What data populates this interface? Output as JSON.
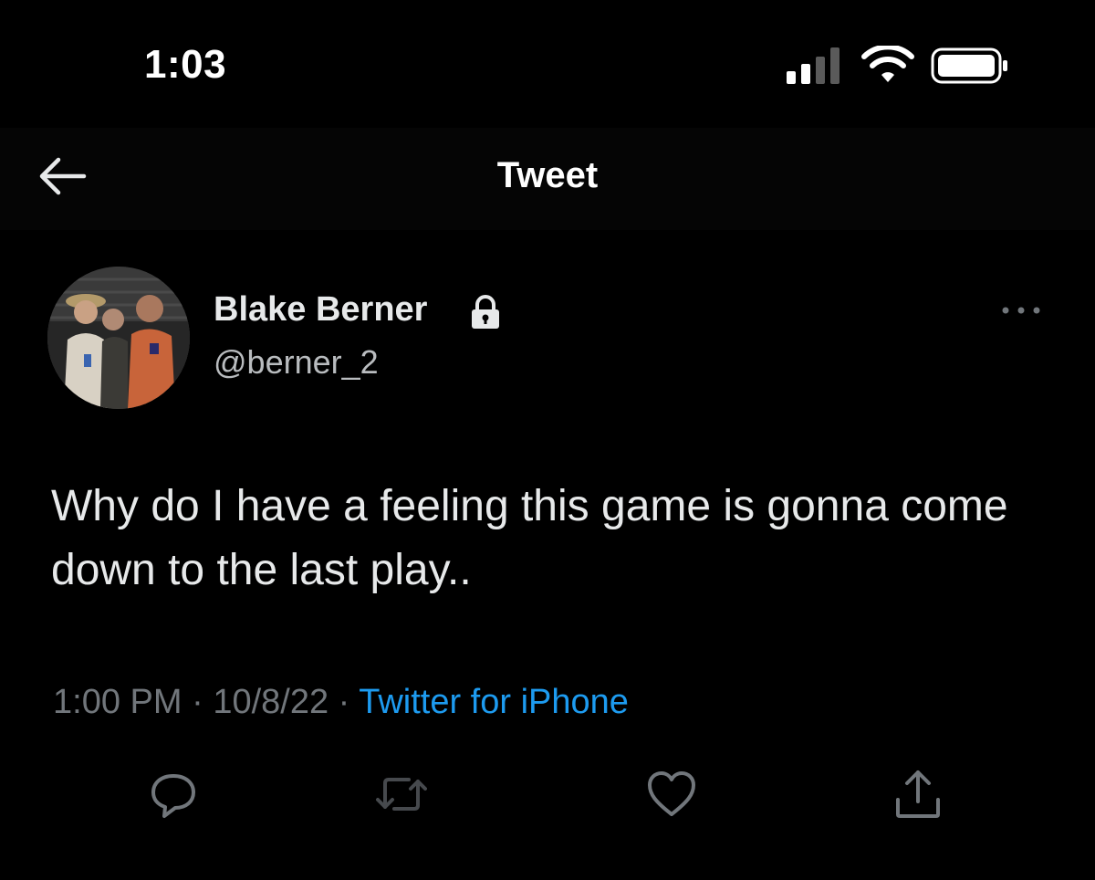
{
  "status_bar": {
    "time": "1:03",
    "signal_icon": "cellular-signal-icon",
    "wifi_icon": "wifi-icon",
    "battery_icon": "battery-icon"
  },
  "header": {
    "back_icon": "back-arrow-icon",
    "title": "Tweet"
  },
  "tweet": {
    "author": {
      "avatar": "avatar",
      "name": "Blake Berner",
      "protected_icon": "lock-icon",
      "handle": "@berner_2"
    },
    "more_icon": "more-options-icon",
    "text": "Why do I have a feeling this game is gonna come down to the last play..",
    "time": "1:00 PM",
    "separator": "·",
    "date": "10/8/22",
    "source": "Twitter for iPhone"
  },
  "actions": {
    "reply_icon": "reply-icon",
    "retweet_icon": "retweet-icon",
    "like_icon": "heart-icon",
    "share_icon": "share-icon"
  },
  "colors": {
    "background": "#000000",
    "text_primary": "#e7e9ea",
    "text_secondary": "#71767b",
    "link": "#1d9bf0"
  }
}
